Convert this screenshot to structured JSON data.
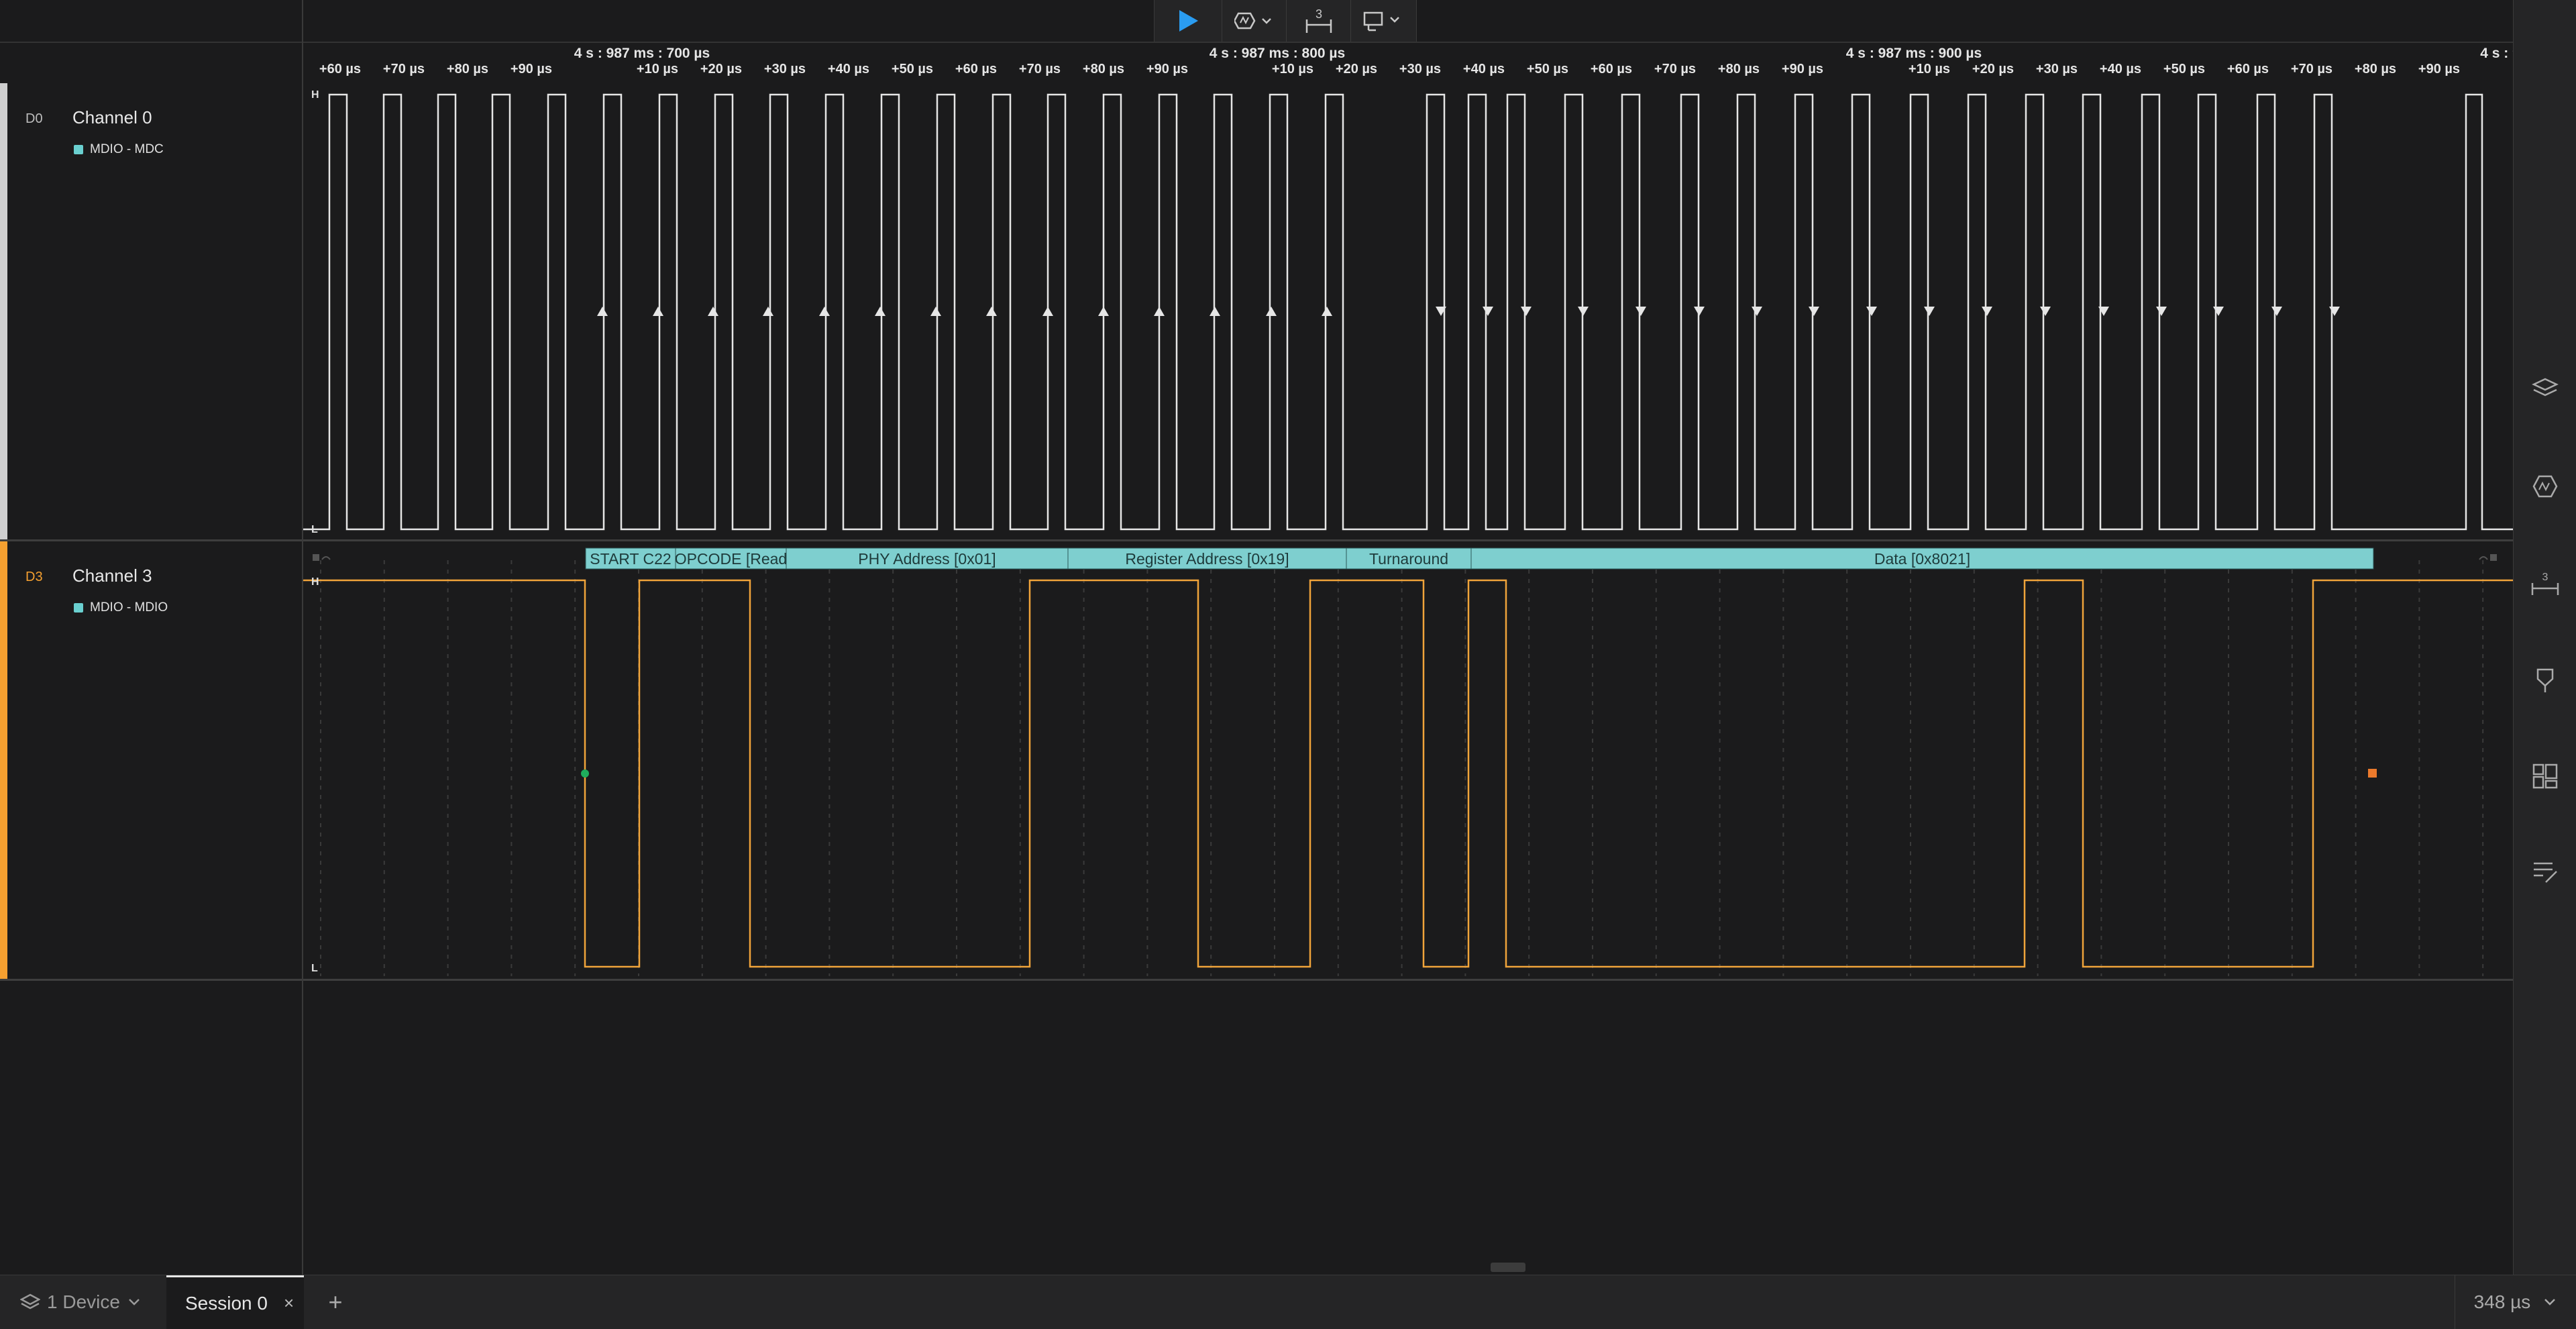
{
  "toolbar": {
    "play_icon": "play-icon",
    "trigger_icon": "trigger-icon",
    "measure_badge": "3",
    "capture_icon": "capture-icon"
  },
  "ruler": {
    "major": [
      "4 s : 987 ms : 700 µs",
      "4 s : 987 ms : 800 µs",
      "4 s : 987 ms : 900 µs",
      "4 s : 9"
    ],
    "minor_a": [
      "+60 µs",
      "+70 µs",
      "+80 µs",
      "+90 µs"
    ],
    "minor_b": [
      "+10 µs",
      "+20 µs",
      "+30 µs",
      "+40 µs",
      "+50 µs",
      "+60 µs",
      "+70 µs",
      "+80 µs",
      "+90 µs"
    ]
  },
  "channels": [
    {
      "id": "D0",
      "name": "Channel 0",
      "analyzer": "MDIO - MDC",
      "accent": "#cfcfcf"
    },
    {
      "id": "D3",
      "name": "Channel 3",
      "analyzer": "MDIO - MDIO",
      "accent": "#f5a030"
    }
  ],
  "levels": {
    "high": "H",
    "low": "L"
  },
  "decoded_frames": [
    {
      "label": "START C22"
    },
    {
      "label": "OPCODE [Read"
    },
    {
      "label": "PHY Address [0x01]"
    },
    {
      "label": "Register Address [0x19]"
    },
    {
      "label": "Turnaround"
    },
    {
      "label": "Data [0x8021]"
    }
  ],
  "colors": {
    "background": "#1b1b1c",
    "channel0_wave": "#e6e6e6",
    "channel3_wave": "#f0a43a",
    "decoder": "#7ecfcf",
    "marker_start": "#1fae5c",
    "marker_end": "#ec7a2c"
  },
  "bottom": {
    "device_label": "1 Device",
    "session_label": "Session 0",
    "close": "×",
    "add": "+",
    "zoom": "348 µs"
  },
  "sidebar_icons": [
    "analyzers-icon",
    "extensions-icon",
    "measurements-icon",
    "annotations-icon",
    "layout-icon",
    "notes-icon"
  ]
}
